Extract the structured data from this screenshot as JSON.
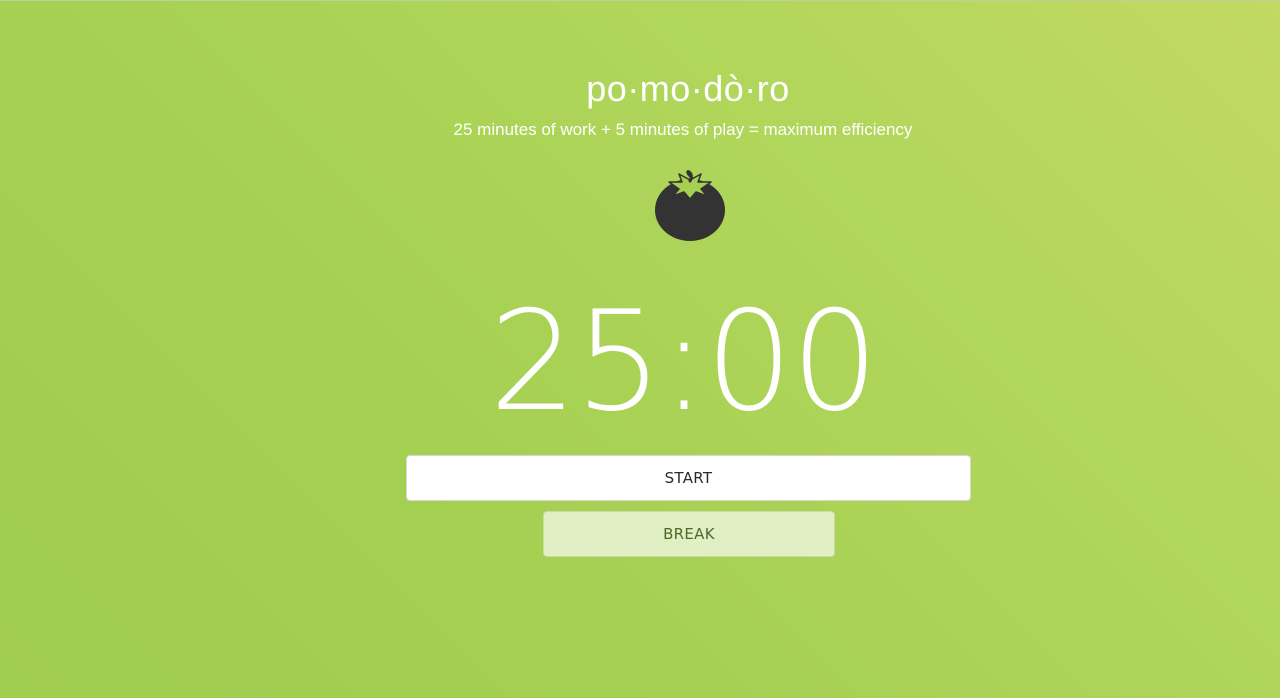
{
  "app": {
    "title": "po·mo·dò·ro",
    "subtitle": "25 minutes of work + 5 minutes of play = maximum efficiency",
    "logo_icon": "tomato-icon"
  },
  "timer": {
    "display": "25:00"
  },
  "buttons": {
    "start_label": "START",
    "break_label": "BREAK"
  },
  "colors": {
    "background": "#a5d052",
    "tomato": "#333333",
    "leaf": "#a5d052",
    "start_bg": "#ffffff",
    "break_bg": "#e1efc5"
  }
}
